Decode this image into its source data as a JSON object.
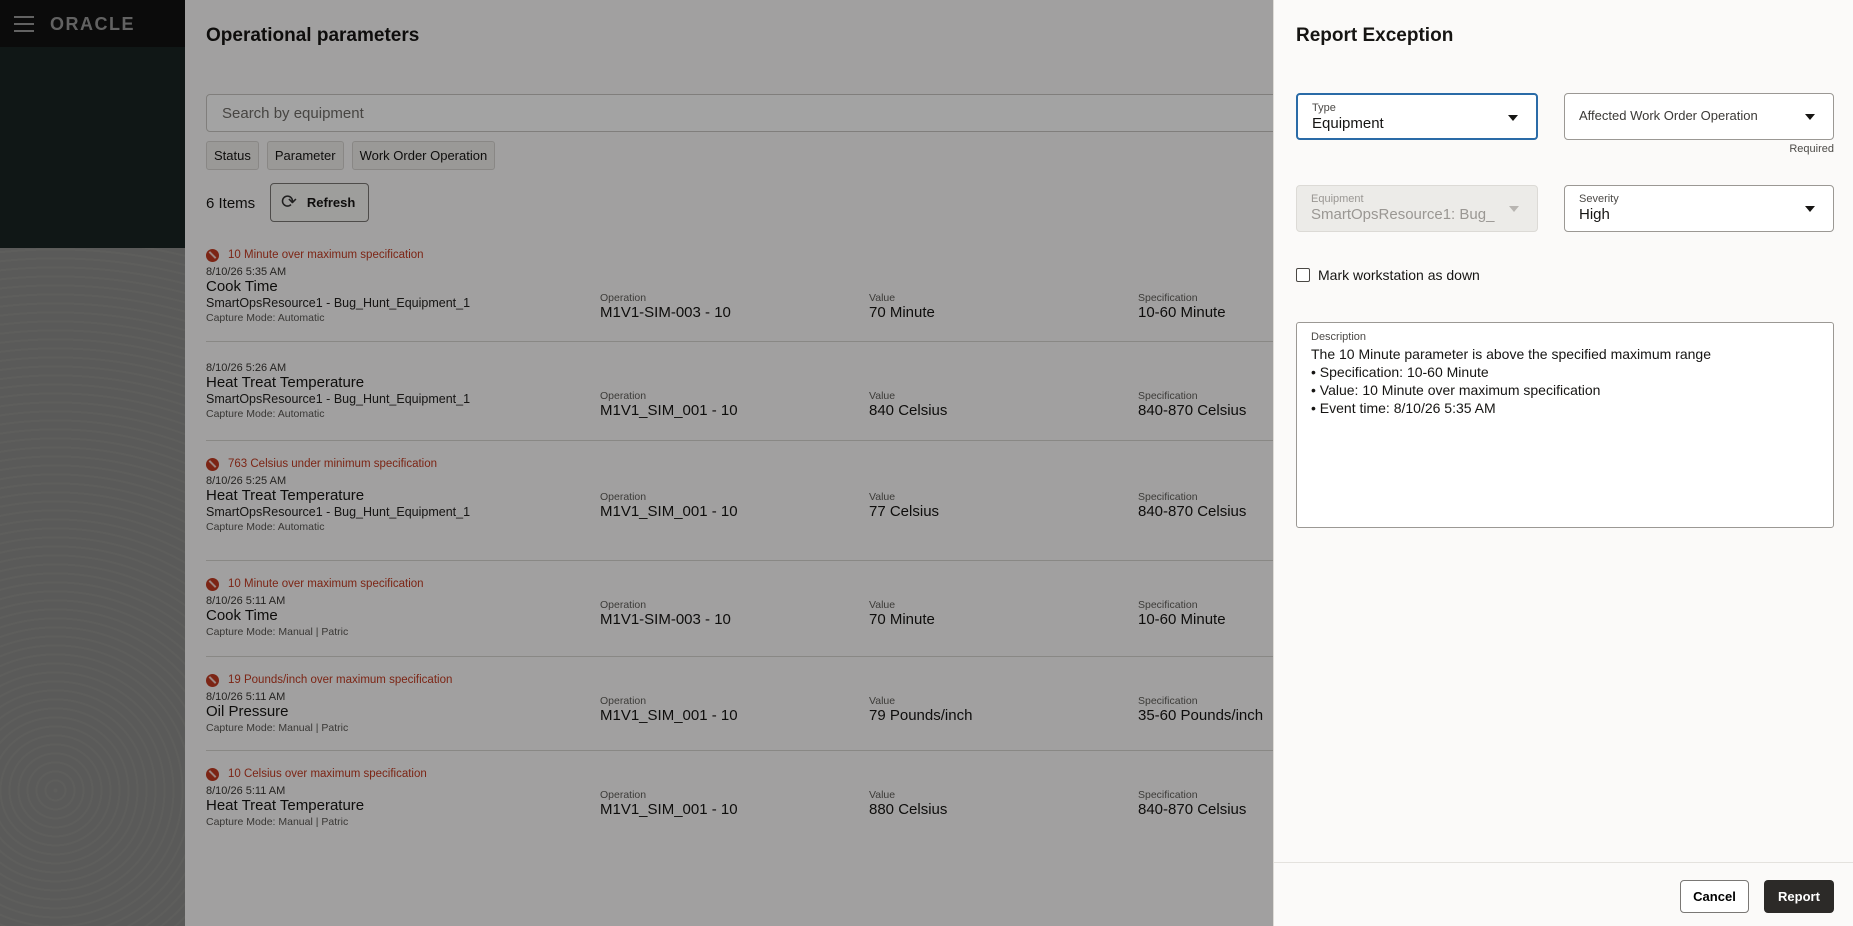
{
  "app": {
    "logo": "ORACLE"
  },
  "page": {
    "title": "Operational parameters",
    "search_placeholder": "Search by equipment",
    "filters": [
      "Status",
      "Parameter",
      "Work Order Operation"
    ],
    "items_count": "6 Items",
    "refresh_label": "Refresh",
    "labels": {
      "operation": "Operation",
      "value": "Value",
      "specification": "Specification"
    },
    "rows": [
      {
        "alert": "10 Minute over maximum specification",
        "timestamp": "8/10/26 5:35 AM",
        "name": "Cook Time",
        "resource": "SmartOpsResource1 - Bug_Hunt_Equipment_1",
        "mode": "Capture Mode: Automatic",
        "operation": "M1V1-SIM-003 - 10",
        "value": "70 Minute",
        "specification": "10-60 Minute"
      },
      {
        "alert": "",
        "timestamp": "8/10/26 5:26 AM",
        "name": "Heat Treat Temperature",
        "resource": "SmartOpsResource1 - Bug_Hunt_Equipment_1",
        "mode": "Capture Mode: Automatic",
        "operation": "M1V1_SIM_001 - 10",
        "value": "840 Celsius",
        "specification": "840-870 Celsius"
      },
      {
        "alert": "763 Celsius under minimum specification",
        "timestamp": "8/10/26 5:25 AM",
        "name": "Heat Treat Temperature",
        "resource": "SmartOpsResource1 - Bug_Hunt_Equipment_1",
        "mode": "Capture Mode: Automatic",
        "operation": "M1V1_SIM_001 - 10",
        "value": "77 Celsius",
        "specification": "840-870 Celsius"
      },
      {
        "alert": "10 Minute over maximum specification",
        "timestamp": "8/10/26 5:11 AM",
        "name": "Cook Time",
        "resource": "",
        "mode": "Capture Mode: Manual | Patric",
        "operation": "M1V1-SIM-003 - 10",
        "value": "70 Minute",
        "specification": "10-60 Minute"
      },
      {
        "alert": "19 Pounds/inch over maximum specification",
        "timestamp": "8/10/26 5:11 AM",
        "name": "Oil Pressure",
        "resource": "",
        "mode": "Capture Mode: Manual | Patric",
        "operation": "M1V1_SIM_001 - 10",
        "value": "79 Pounds/inch",
        "specification": "35-60 Pounds/inch"
      },
      {
        "alert": "10 Celsius over maximum specification",
        "timestamp": "8/10/26 5:11 AM",
        "name": "Heat Treat Temperature",
        "resource": "",
        "mode": "Capture Mode: Manual | Patric",
        "operation": "M1V1_SIM_001 - 10",
        "value": "880 Celsius",
        "specification": "840-870 Celsius"
      }
    ]
  },
  "drawer": {
    "title": "Report Exception",
    "type": {
      "label": "Type",
      "value": "Equipment"
    },
    "affected_work_order": {
      "placeholder": "Affected Work Order Operation",
      "helper": "Required"
    },
    "equipment": {
      "label": "Equipment",
      "value": "SmartOpsResource1: Bug_"
    },
    "severity": {
      "label": "Severity",
      "value": "High"
    },
    "mark_down_label": "Mark workstation as down",
    "description": {
      "label": "Description",
      "text": "The 10 Minute parameter is above the specified maximum range\n• Specification: 10-60 Minute\n• Value: 10 Minute over maximum specification\n• Event time: 8/10/26 5:35 AM"
    },
    "cancel_label": "Cancel",
    "report_label": "Report"
  },
  "colors": {
    "alert": "#c23a22",
    "focus": "#2a6ba7",
    "primary_button": "#2c2a28",
    "rail_dark": "#1a2423"
  },
  "icons": [
    "hamburger-icon",
    "search-icon",
    "refresh-icon",
    "error-icon",
    "chevron-down-icon"
  ]
}
